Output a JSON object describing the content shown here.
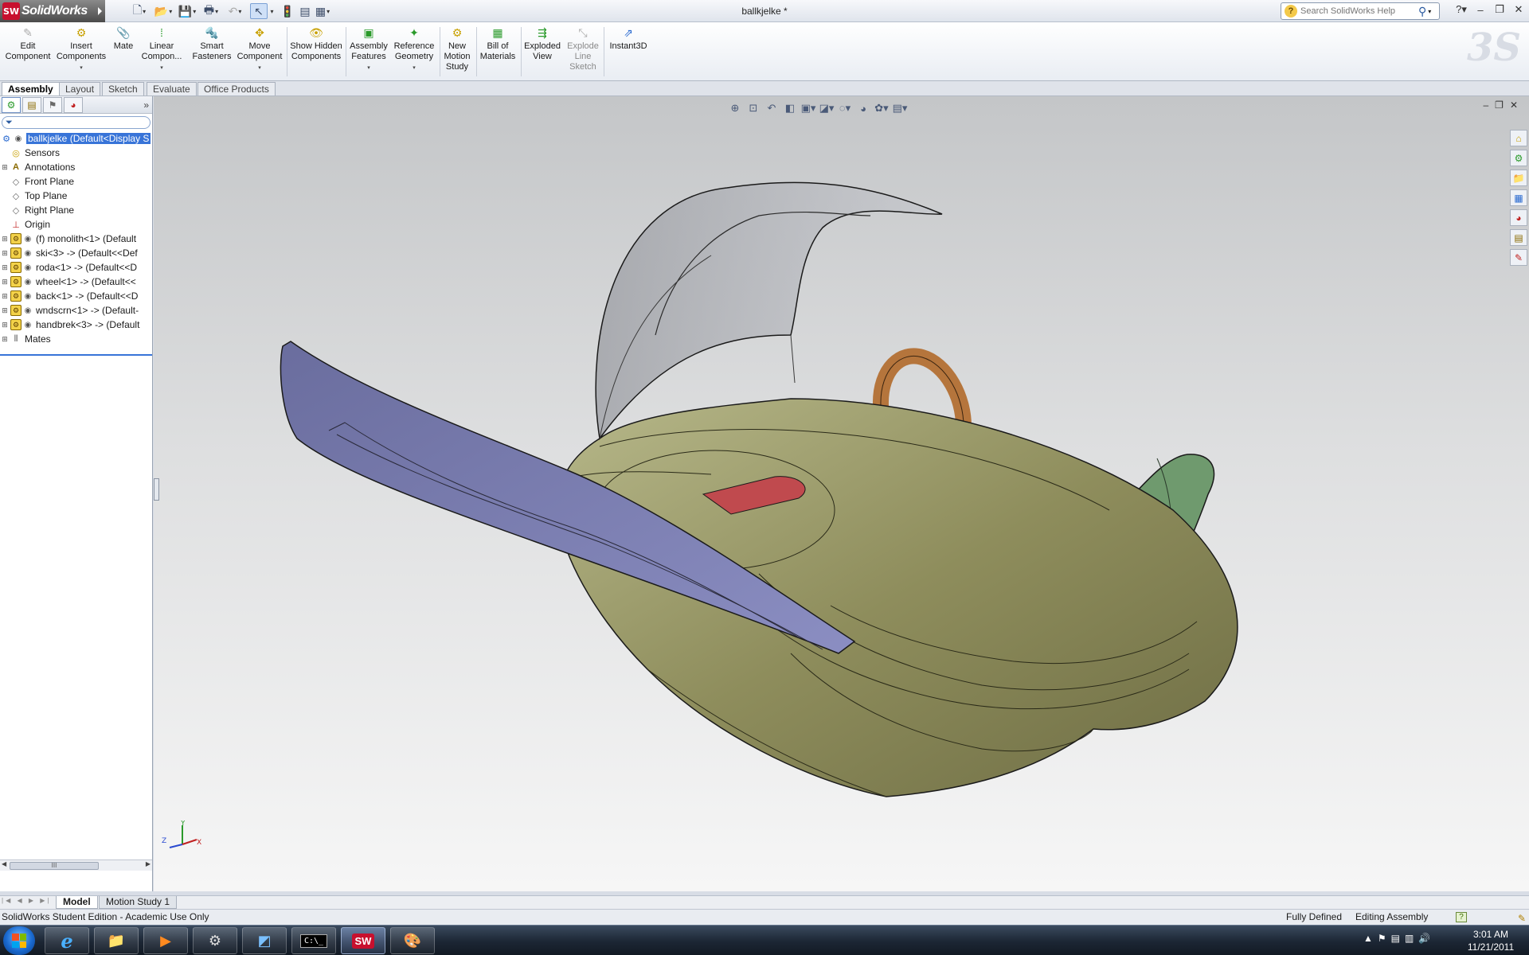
{
  "app": {
    "brand": "SolidWorks",
    "brand_badge": "SW",
    "document_title": "ballkjelke *"
  },
  "help_search": {
    "placeholder": "Search SolidWorks Help"
  },
  "commands": [
    {
      "label": "Edit Component",
      "enabled": false
    },
    {
      "label": "Insert Components",
      "enabled": true
    },
    {
      "label": "Mate",
      "enabled": true
    },
    {
      "label": "Linear Compon...",
      "enabled": true
    },
    {
      "label": "Smart Fasteners",
      "enabled": true
    },
    {
      "label": "Move Component",
      "enabled": true
    },
    {
      "label": "Show Hidden Components",
      "enabled": true
    },
    {
      "label": "Assembly Features",
      "enabled": true
    },
    {
      "label": "Reference Geometry",
      "enabled": true
    },
    {
      "label": "New Motion Study",
      "enabled": true
    },
    {
      "label": "Bill of Materials",
      "enabled": true
    },
    {
      "label": "Exploded View",
      "enabled": true
    },
    {
      "label": "Explode Line Sketch",
      "enabled": false
    },
    {
      "label": "Instant3D",
      "enabled": true
    }
  ],
  "tabs": [
    "Assembly",
    "Layout",
    "Sketch",
    "Evaluate",
    "Office Products"
  ],
  "active_tab": "Assembly",
  "tree": {
    "root": "ballkjelke  (Default<Display S",
    "items": [
      {
        "label": "Sensors"
      },
      {
        "label": "Annotations"
      },
      {
        "label": "Front Plane"
      },
      {
        "label": "Top Plane"
      },
      {
        "label": "Right Plane"
      },
      {
        "label": "Origin"
      },
      {
        "label": "(f) monolith<1> (Default"
      },
      {
        "label": "ski<3> -> (Default<<Def"
      },
      {
        "label": "roda<1> -> (Default<<D"
      },
      {
        "label": "wheel<1> -> (Default<<"
      },
      {
        "label": "back<1> -> (Default<<D"
      },
      {
        "label": "wndscrn<1> -> (Default-"
      },
      {
        "label": "handbrek<3> -> (Default"
      },
      {
        "label": "Mates"
      }
    ]
  },
  "scroll_thumb_label": "III",
  "triad": {
    "x": "X",
    "y": "Y",
    "z": "Z"
  },
  "bottom_tabs": [
    "Model",
    "Motion Study 1"
  ],
  "status": {
    "left": "SolidWorks Student Edition - Academic Use Only",
    "definition": "Fully Defined",
    "mode": "Editing Assembly"
  },
  "taskbar": {
    "cmd_label": "C:\\_",
    "sw_label": "SW"
  },
  "clock": {
    "time": "3:01 AM",
    "date": "11/21/2011"
  },
  "colors": {
    "body": "#8e8d5c",
    "ski": "#7d80b4",
    "windshield": "#a8aab0",
    "handle": "#b5753c",
    "fin": "#6f9a6e",
    "red_part": "#c04a4e",
    "selection": "#3874d8"
  }
}
